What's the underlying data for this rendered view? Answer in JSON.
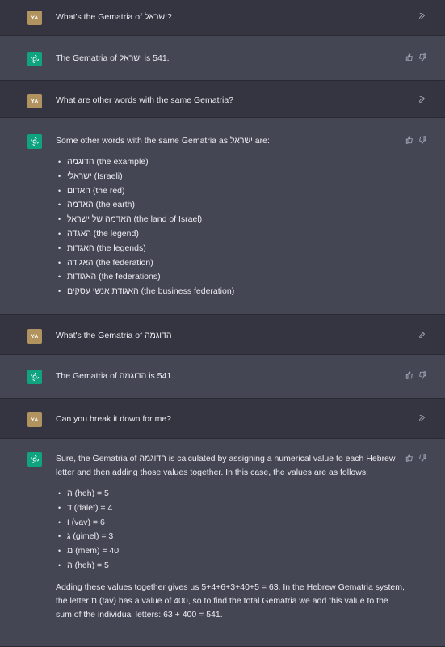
{
  "user_avatar_text": "YA",
  "messages": {
    "m1": {
      "text": "What's the Gematria of ישראל?"
    },
    "m2": {
      "text": "The Gematria of ישראל is 541."
    },
    "m3": {
      "text": "What are other words with the same Gematria?"
    },
    "m4": {
      "intro": "Some other words with the same Gematria as ישראל are:",
      "items": [
        "הדוגמה (the example)",
        "ישראלי (Israeli)",
        "האדום (the red)",
        "האדמה (the earth)",
        "האדמה של ישראל (the land of Israel)",
        "האגדה (the legend)",
        "האגדות (the legends)",
        "האגודה (the federation)",
        "האגודות (the federations)",
        "האגודת אנשי עסקים (the business federation)"
      ]
    },
    "m5": {
      "text": "What's the Gematria of הדוגמה"
    },
    "m6": {
      "text": "The Gematria of הדוגמה is 541."
    },
    "m7": {
      "text": "Can you break it down for me?"
    },
    "m8": {
      "intro": "Sure, the Gematria of הדוגמה is calculated by assigning a numerical value to each Hebrew letter and then adding those values together. In this case, the values are as follows:",
      "items": [
        "ה (heh) = 5",
        "ד (dalet) = 4",
        "ו (vav) = 6",
        "ג (gimel) = 3",
        "מ (mem) = 40",
        "ה (heh) = 5"
      ],
      "outro": "Adding these values together gives us 5+4+6+3+40+5 = 63. In the Hebrew Gematria system, the letter ת (tav) has a value of 400, so to find the total Gematria we add this value to the sum of the individual letters: 63 + 400 = 541."
    }
  },
  "icons": {
    "edit": "edit-icon",
    "thumbs_up": "thumbs-up-icon",
    "thumbs_down": "thumbs-down-icon",
    "bot": "openai-logo-icon"
  },
  "colors": {
    "user_bg": "#343541",
    "bot_bg": "#444654",
    "user_avatar": "#b1935f",
    "bot_avatar": "#10a37f"
  }
}
